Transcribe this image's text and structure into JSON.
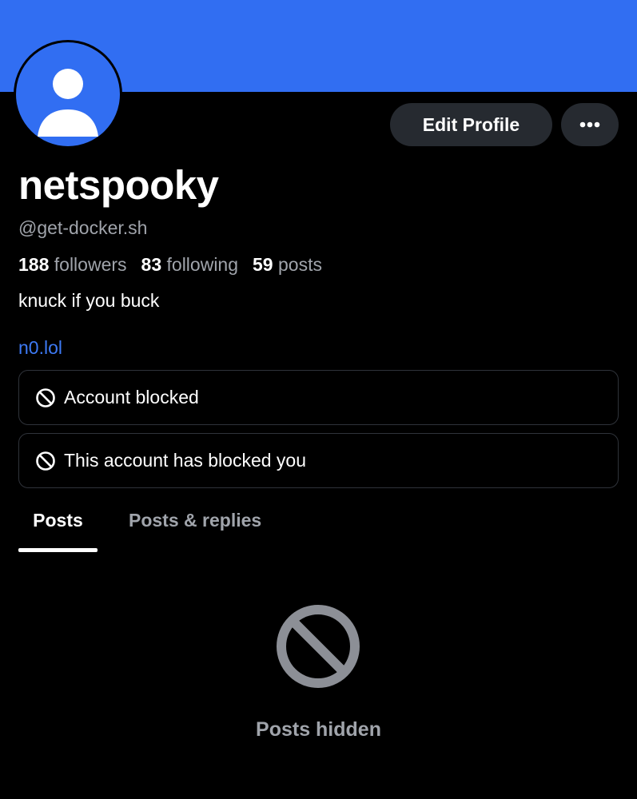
{
  "profile": {
    "display_name": "netspooky",
    "handle": "@get-docker.sh",
    "bio": "knuck if you buck",
    "link": "n0.lol",
    "banner_color": "#316ef2",
    "avatar_color": "#316ef2"
  },
  "actions": {
    "edit_label": "Edit Profile",
    "more_icon": "ellipsis-icon"
  },
  "stats": {
    "followers_count": "188",
    "followers_label": "followers",
    "following_count": "83",
    "following_label": "following",
    "posts_count": "59",
    "posts_label": "posts"
  },
  "alerts": [
    {
      "icon": "blocked-icon",
      "text": "Account blocked"
    },
    {
      "icon": "blocked-icon",
      "text": "This account has blocked you"
    }
  ],
  "tabs": [
    {
      "label": "Posts",
      "active": true
    },
    {
      "label": "Posts & replies",
      "active": false
    }
  ],
  "empty_state": {
    "icon": "blocked-icon",
    "text": "Posts hidden"
  }
}
